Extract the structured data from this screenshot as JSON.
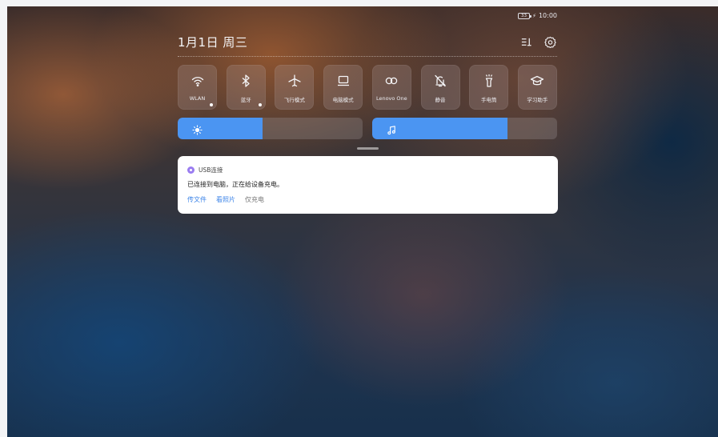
{
  "status_bar": {
    "battery_level": "33",
    "time": "10:00"
  },
  "header": {
    "date": "1月1日 周三",
    "edit_icon": "edit-toggles-icon",
    "settings_icon": "gear-icon"
  },
  "toggles": [
    {
      "label": "WLAN",
      "icon": "wifi-icon",
      "active": true,
      "has_more": true
    },
    {
      "label": "蓝牙",
      "icon": "bluetooth-icon",
      "active": true,
      "has_more": true
    },
    {
      "label": "飞行模式",
      "icon": "airplane-icon",
      "active": false,
      "has_more": false
    },
    {
      "label": "电脑模式",
      "icon": "laptop-icon",
      "active": false,
      "has_more": false
    },
    {
      "label": "Lenovo One",
      "icon": "infinity-icon",
      "active": false,
      "has_more": false
    },
    {
      "label": "静音",
      "icon": "bell-off-icon",
      "active": false,
      "has_more": false
    },
    {
      "label": "手电筒",
      "icon": "flashlight-icon",
      "active": false,
      "has_more": false
    },
    {
      "label": "学习助手",
      "icon": "graduation-cap-icon",
      "active": false,
      "has_more": false
    }
  ],
  "sliders": {
    "brightness": {
      "icon": "sun-icon",
      "value_fraction": 0.46
    },
    "volume": {
      "icon": "music-note-icon",
      "value_fraction": 0.73
    }
  },
  "notification": {
    "app_name": "USB连接",
    "app_color": "#9a7cf0",
    "message": "已连接到电脑，正在给设备充电。",
    "actions": [
      "传文件",
      "看照片",
      "仅充电"
    ]
  },
  "colors": {
    "accent": "#4b95f2",
    "link": "#3f86e8"
  }
}
